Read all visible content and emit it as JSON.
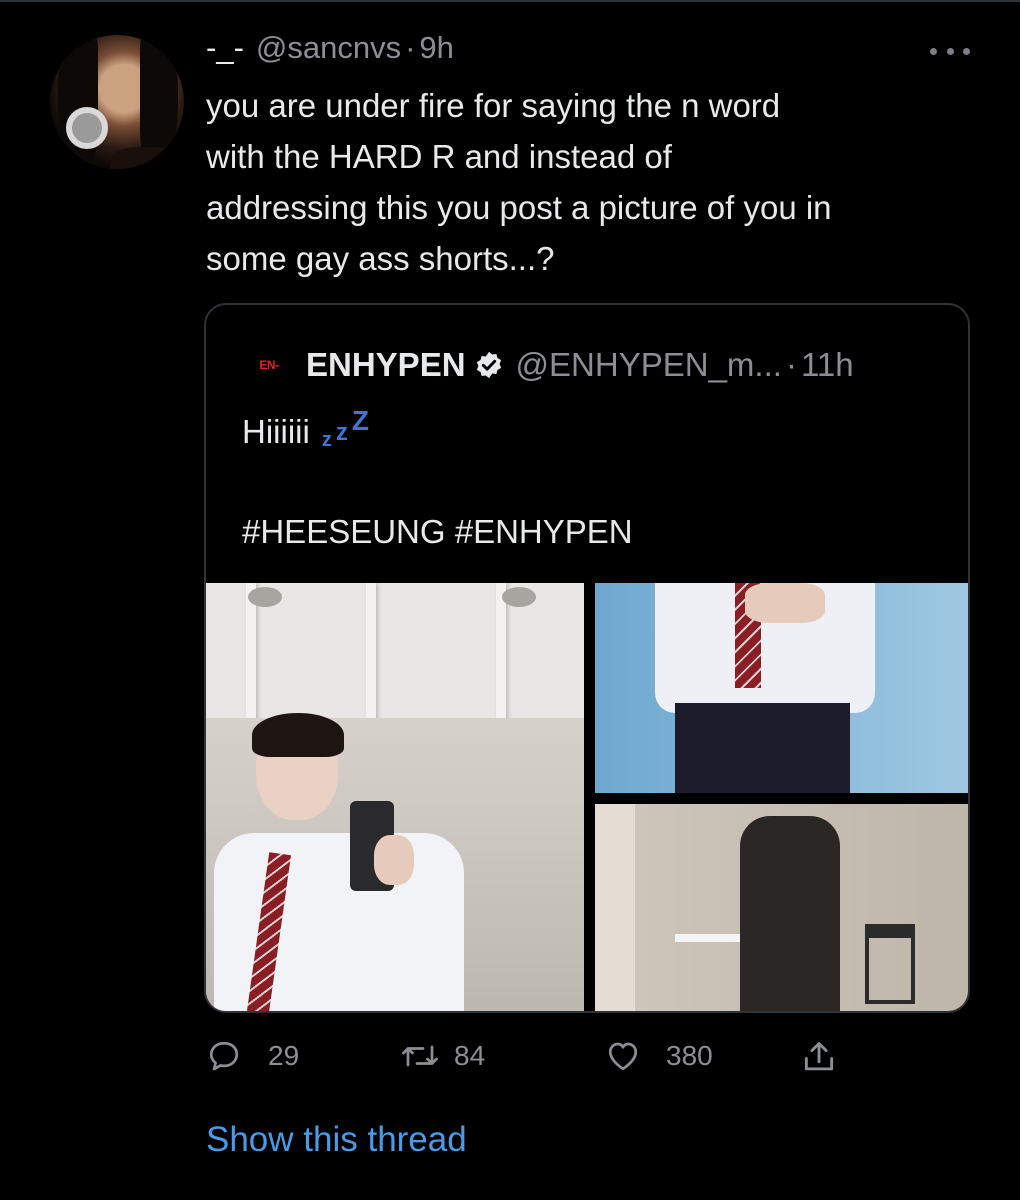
{
  "tweet": {
    "display_name": "-_-",
    "handle": "@sancnvs",
    "separator": "·",
    "time": "9h",
    "text": "you are under fire for saying the n word\nwith the HARD R and instead of\naddressing this you post a picture of you in\nsome gay ass shorts...?",
    "more_icon": "more-horizontal-icon"
  },
  "quote": {
    "logo_text": "EN-",
    "name": "ENHYPEN",
    "verified_icon": "verified-badge-icon",
    "handle": "@ENHYPEN_m...",
    "separator": "·",
    "time": "11h",
    "line1": "Hiiiiii",
    "zzz": [
      "z",
      "z",
      "Z"
    ],
    "line2": "#HEESEUNG #ENHYPEN"
  },
  "actions": {
    "reply": {
      "icon": "reply-bubble-icon",
      "count": "29"
    },
    "retweet": {
      "icon": "retweet-icon",
      "count": "84"
    },
    "like": {
      "icon": "heart-icon",
      "count": "380"
    },
    "share": {
      "icon": "share-icon"
    }
  },
  "show_thread": "Show this thread",
  "colors": {
    "background": "#000000",
    "text": "#e7e9ea",
    "secondary": "#8b8f94",
    "link": "#4a9ae8",
    "border": "#2f3336",
    "logo_red": "#e0222f",
    "emoji_blue": "#3b76d8"
  }
}
